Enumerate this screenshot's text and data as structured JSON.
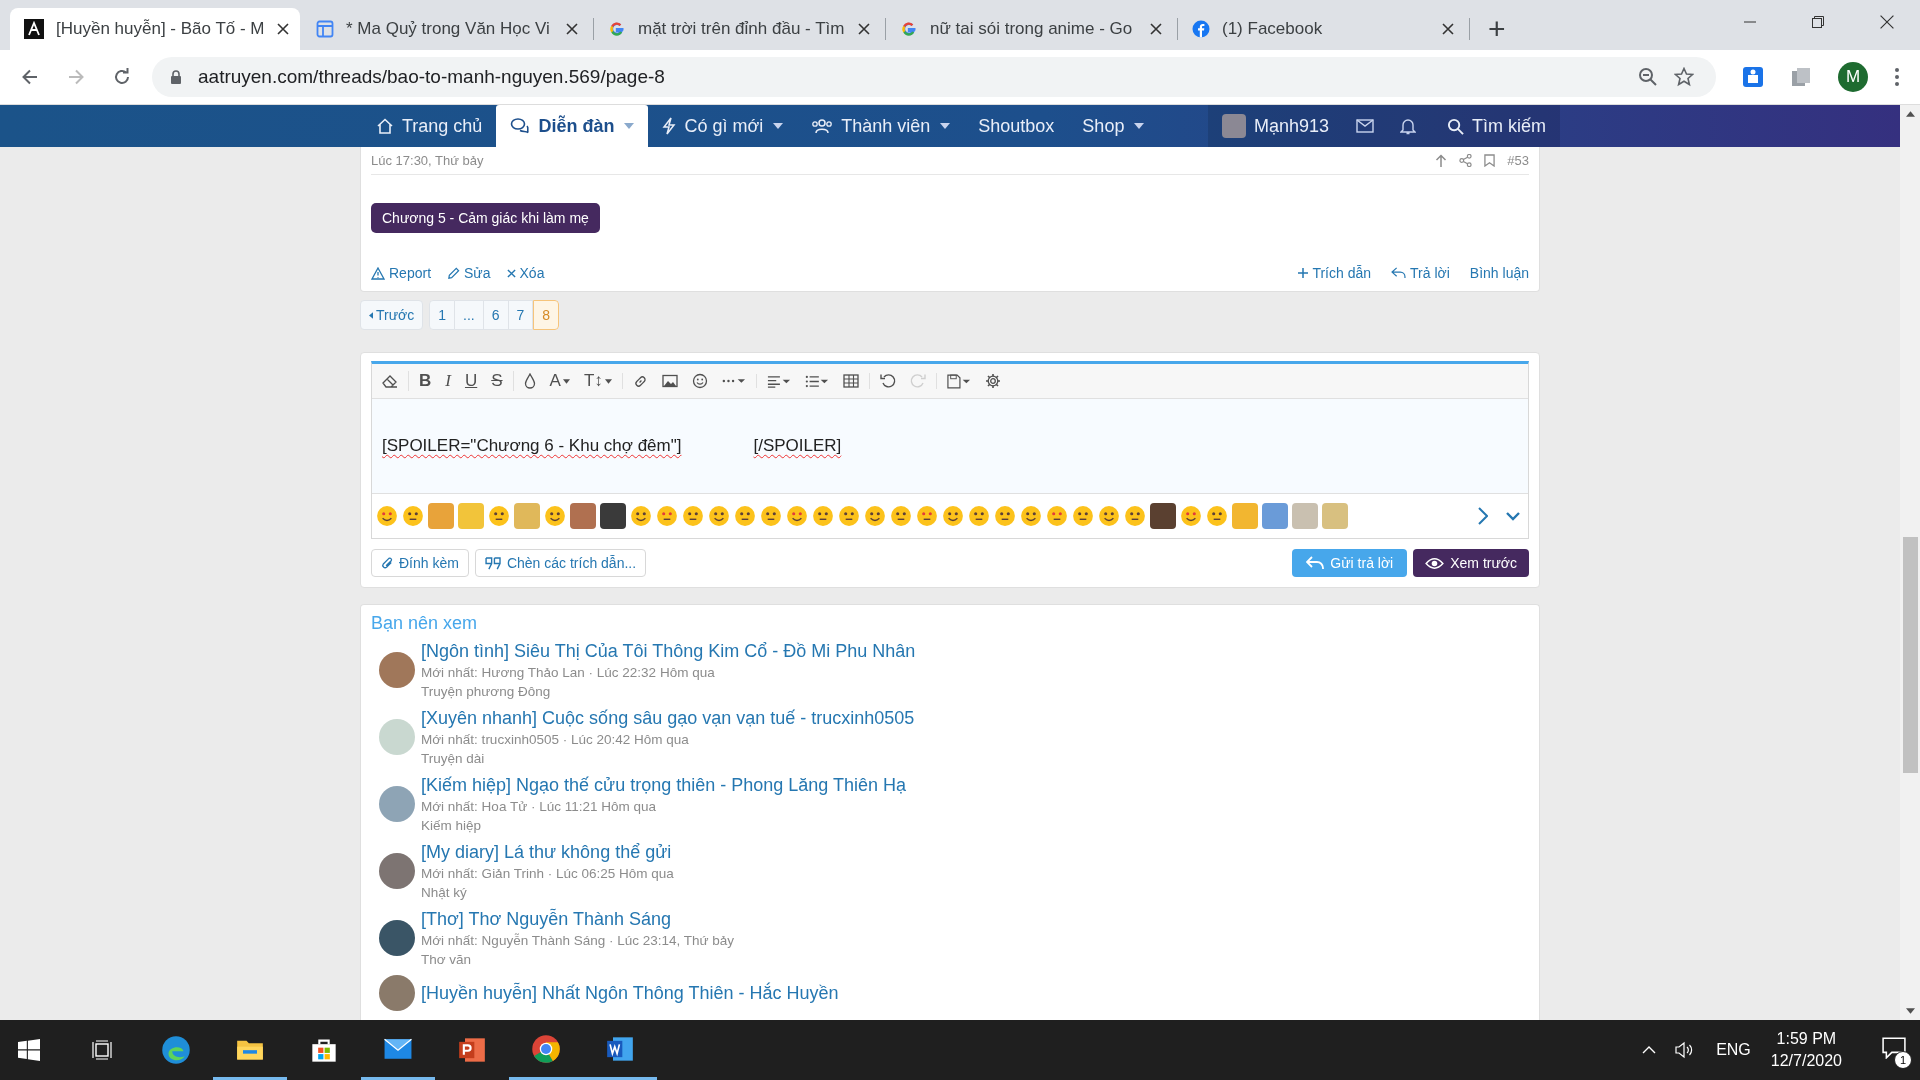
{
  "browser": {
    "tabs": [
      {
        "kind": "site",
        "title": "[Huyền huyễn] - Bão Tố - M",
        "selected": true
      },
      {
        "kind": "docs",
        "title": "* Ma Quỷ trong Văn Học Vi",
        "selected": false
      },
      {
        "kind": "google",
        "title": "mặt trời trên đỉnh đầu - Tìm",
        "selected": false
      },
      {
        "kind": "google",
        "title": "nữ tai sói trong anime - Go",
        "selected": false
      },
      {
        "kind": "facebook",
        "title": "(1) Facebook",
        "selected": false
      }
    ],
    "new_tab": "+",
    "address": "aatruyen.com/threads/bao-to-manh-nguyen.569/page-8",
    "profile": "M"
  },
  "nav": {
    "items": [
      {
        "label": "Trang chủ",
        "kind": "home",
        "dropdown": false,
        "selected": false
      },
      {
        "label": "Diễn đàn",
        "kind": "forum",
        "dropdown": true,
        "selected": true
      },
      {
        "label": "Có gì mới",
        "kind": "new",
        "dropdown": true,
        "selected": false
      },
      {
        "label": "Thành viên",
        "kind": "members",
        "dropdown": true,
        "selected": false
      },
      {
        "label": "Shoutbox",
        "kind": "plain",
        "dropdown": false,
        "selected": false
      },
      {
        "label": "Shop",
        "kind": "plain",
        "dropdown": true,
        "selected": false
      }
    ],
    "user": "Mạnh913",
    "search": "Tìm kiếm"
  },
  "post": {
    "time": "Lúc 17:30, Thứ bảy",
    "number": "#53",
    "spoiler": "Chương 5 - Cảm giác khi làm mẹ",
    "actions_left": [
      {
        "kind": "report",
        "label": "Report"
      },
      {
        "kind": "edit",
        "label": "Sửa"
      },
      {
        "kind": "delete",
        "label": "Xóa"
      }
    ],
    "actions_right": [
      {
        "kind": "quote",
        "label": "Trích dẫn"
      },
      {
        "kind": "reply",
        "label": "Trả lời"
      },
      {
        "kind": "plain",
        "label": "Bình luận"
      }
    ]
  },
  "pagination": {
    "prev": "Trước",
    "pages": [
      {
        "label": "1",
        "selected": false
      },
      {
        "label": "...",
        "selected": false
      },
      {
        "label": "6",
        "selected": false
      },
      {
        "label": "7",
        "selected": false
      },
      {
        "label": "8",
        "selected": true
      }
    ]
  },
  "editor": {
    "toolbar": [
      [
        {
          "kind": "eraser"
        }
      ],
      [
        {
          "kind": "bold",
          "label": "B"
        },
        {
          "kind": "italic",
          "label": "I"
        },
        {
          "kind": "underline",
          "label": "U"
        },
        {
          "kind": "strike",
          "label": "S"
        }
      ],
      [
        {
          "kind": "color"
        },
        {
          "kind": "font",
          "label": "A"
        },
        {
          "kind": "size",
          "label": "T↕"
        }
      ],
      [
        {
          "kind": "link"
        },
        {
          "kind": "image"
        },
        {
          "kind": "smiley"
        },
        {
          "kind": "more"
        }
      ],
      [
        {
          "kind": "align"
        },
        {
          "kind": "list"
        },
        {
          "kind": "table"
        }
      ],
      [
        {
          "kind": "undo",
          "disabled": false
        },
        {
          "kind": "redo",
          "disabled": true
        }
      ],
      [
        {
          "kind": "save"
        },
        {
          "kind": "settings"
        }
      ]
    ],
    "text_open": "[SPOILER=\"Chương 6 - Khu chợ đêm\"]",
    "text_close": "[/SPOILER]",
    "buttons_left": [
      {
        "kind": "attach",
        "label": "Đính kèm"
      },
      {
        "kind": "quotes",
        "label": "Chèn các trích dẫn..."
      }
    ],
    "buttons_right": [
      {
        "kind": "reply",
        "label": "Gửi trả lời"
      },
      {
        "kind": "preview",
        "label": "Xem trước"
      }
    ]
  },
  "suggested": {
    "title": "Bạn nên xem",
    "items": [
      {
        "title": "[Ngôn tình] Siêu Thị Của Tôi Thông Kim Cổ - Đồ Mi Phu Nhân",
        "meta": "Mới nhất: Hương Thảo Lan · Lúc 22:32 Hôm qua",
        "category": "Truyện phương Đông"
      },
      {
        "title": "[Xuyên nhanh] Cuộc sống sâu gạo vạn vạn tuế - trucxinh0505",
        "meta": "Mới nhất: trucxinh0505 · Lúc 20:42 Hôm qua",
        "category": "Truyện dài"
      },
      {
        "title": "[Kiếm hiệp] Ngạo thế cửu trọng thiên - Phong Lăng Thiên Hạ",
        "meta": "Mới nhất: Hoa Tử · Lúc 11:21 Hôm qua",
        "category": "Kiếm hiệp"
      },
      {
        "title": "[My diary] Lá thư không thể gửi",
        "meta": "Mới nhất: Giản Trinh · Lúc 06:25 Hôm qua",
        "category": "Nhật ký"
      },
      {
        "title": "[Thơ] Thơ Nguyễn Thành Sáng",
        "meta": "Mới nhất: Nguyễn Thành Sáng · Lúc 23:14, Thứ bảy",
        "category": "Thơ văn"
      },
      {
        "title": "[Huyền huyễn] Nhất Ngôn Thông Thiên - Hắc Huyền"
      }
    ]
  },
  "taskbar": {
    "apps": [
      {
        "kind": "taskview",
        "active": false
      },
      {
        "kind": "edge",
        "active": false
      },
      {
        "kind": "explorer",
        "active": true
      },
      {
        "kind": "store",
        "active": false
      },
      {
        "kind": "mail",
        "active": true
      },
      {
        "kind": "powerpoint",
        "active": false
      },
      {
        "kind": "chrome",
        "active": true
      },
      {
        "kind": "word",
        "active": true
      }
    ],
    "language": "ENG",
    "time": "1:59 PM",
    "date": "12/7/2020",
    "notifications": "1"
  }
}
